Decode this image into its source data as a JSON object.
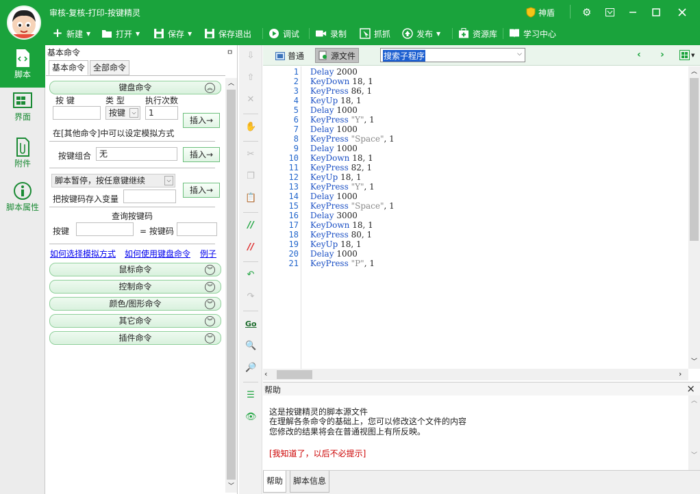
{
  "window": {
    "title": "审核-复核-打印-按键精灵",
    "shield_label": "神盾"
  },
  "toolbar": [
    {
      "label": "新建",
      "icon": "plus-icon"
    },
    {
      "label": "打开",
      "icon": "folder-icon"
    },
    {
      "label": "保存",
      "icon": "floppy-icon"
    },
    {
      "label": "保存退出",
      "icon": "floppy-exit-icon"
    },
    {
      "label": "调试",
      "icon": "play-icon"
    },
    {
      "label": "录制",
      "icon": "camera-icon"
    },
    {
      "label": "抓抓",
      "icon": "capture-icon"
    },
    {
      "label": "发布",
      "icon": "publish-icon"
    },
    {
      "label": "资源库",
      "icon": "resource-icon"
    },
    {
      "label": "学习中心",
      "icon": "book-icon"
    }
  ],
  "leftnav": [
    {
      "label": "脚本",
      "icon": "script-icon"
    },
    {
      "label": "界面",
      "icon": "layout-icon"
    },
    {
      "label": "附件",
      "icon": "attachment-icon"
    },
    {
      "label": "脚本属性",
      "icon": "info-icon"
    }
  ],
  "panel": {
    "title": "基本命令",
    "pin": "ㅁ",
    "tabs": [
      "基本命令",
      "全部命令"
    ],
    "keyboard": {
      "header": "键盘命令",
      "col_key": "按 键",
      "col_type": "类 型",
      "col_times": "执行次数",
      "type_value": "按键",
      "times_value": "1",
      "insert": "插入→",
      "note": "在[其他命令]中可以设定模拟方式",
      "combo_label": "按键组合",
      "combo_value": "无",
      "pause_value": "脚本暂停，按任意键继续",
      "store_label": "把按键码存入变量",
      "query_title": "查询按键码",
      "query_key": "按键",
      "query_code": "= 按键码",
      "links": [
        "如何选择模拟方式",
        "如何使用键盘命令",
        "例子"
      ]
    },
    "sections": [
      "鼠标命令",
      "控制命令",
      "颜色/图形命令",
      "其它命令",
      "插件命令"
    ]
  },
  "editor": {
    "view_normal": "普通",
    "view_source": "源文件",
    "search_value": "搜索子程序",
    "lines": [
      {
        "n": "1",
        "kw": "Delay",
        "arg": " 2000"
      },
      {
        "n": "2",
        "kw": "KeyDown",
        "arg": " 18, 1"
      },
      {
        "n": "3",
        "kw": "KeyPress",
        "arg": " 86, 1"
      },
      {
        "n": "4",
        "kw": "KeyUp",
        "arg": " 18, 1"
      },
      {
        "n": "5",
        "kw": "Delay",
        "arg": " 1000"
      },
      {
        "n": "6",
        "kw": "KeyPress",
        "str": " \"Y\"",
        "arg": ", 1"
      },
      {
        "n": "7",
        "kw": "Delay",
        "arg": " 1000"
      },
      {
        "n": "8",
        "kw": "KeyPress",
        "str": " \"Space\"",
        "arg": ", 1"
      },
      {
        "n": "9",
        "kw": "Delay",
        "arg": " 1000"
      },
      {
        "n": "10",
        "kw": "KeyDown",
        "arg": " 18, 1"
      },
      {
        "n": "11",
        "kw": "KeyPress",
        "arg": " 82, 1"
      },
      {
        "n": "12",
        "kw": "KeyUp",
        "arg": " 18, 1"
      },
      {
        "n": "13",
        "kw": "KeyPress",
        "str": " \"Y\"",
        "arg": ", 1"
      },
      {
        "n": "14",
        "kw": "Delay",
        "arg": " 1000"
      },
      {
        "n": "15",
        "kw": "KeyPress",
        "str": " \"Space\"",
        "arg": ", 1"
      },
      {
        "n": "16",
        "kw": "Delay",
        "arg": " 3000"
      },
      {
        "n": "17",
        "kw": "KeyDown",
        "arg": " 18, 1"
      },
      {
        "n": "18",
        "kw": "KeyPress",
        "arg": " 80, 1"
      },
      {
        "n": "19",
        "kw": "KeyUp",
        "arg": " 18, 1"
      },
      {
        "n": "20",
        "kw": "Delay",
        "arg": " 1000"
      },
      {
        "n": "21",
        "kw": "KeyPress",
        "str": " \"P\"",
        "arg": ", 1"
      }
    ]
  },
  "help": {
    "title": "帮助",
    "close": "×",
    "lines": [
      "这是按键精灵的脚本源文件",
      "在理解各条命令的基础上，您可以修改这个文件的内容",
      "您修改的结果将会在普通视图上有所反映。"
    ],
    "dismiss": "[我知道了，以后不必提示]",
    "tabs": [
      "帮助",
      "脚本信息"
    ]
  },
  "colors": {
    "brand": "#1aa33c",
    "link": "#0000ee",
    "warn": "#cc0000"
  }
}
